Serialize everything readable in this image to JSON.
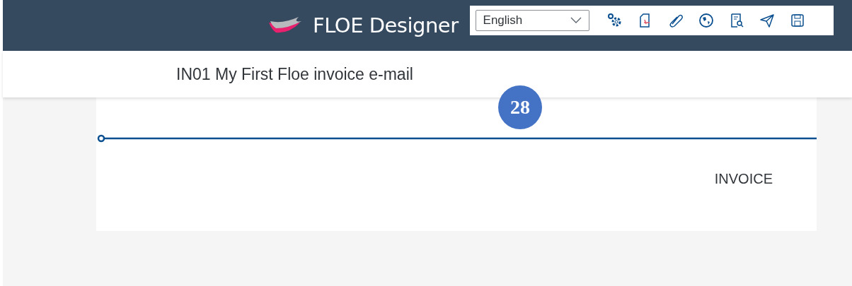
{
  "header": {
    "title": "FLOE Designer",
    "language": {
      "value": "English"
    }
  },
  "document": {
    "title": "IN01 My First Floe invoice e-mail"
  },
  "callout": {
    "number": "28"
  },
  "preview": {
    "heading": "INVOICE"
  }
}
